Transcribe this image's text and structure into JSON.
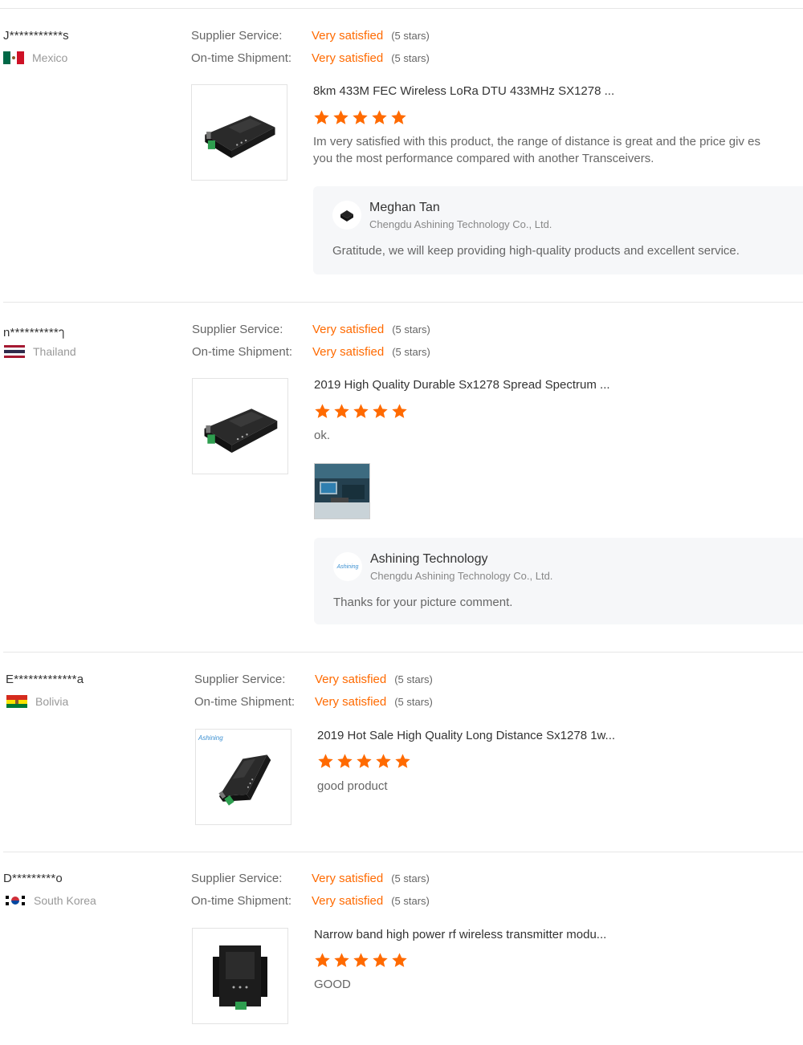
{
  "labels": {
    "supplier_service": "Supplier Service:",
    "ontime_shipment": "On-time Shipment:",
    "stars_note": "(5 stars)"
  },
  "colors": {
    "accent": "#ff6a00",
    "separator": "#e6e6e6",
    "reply_bg": "#f6f7f9"
  },
  "reviews": [
    {
      "buyer": "J***********s",
      "country": "Mexico",
      "flag": "mexico-flag",
      "supplier_service": "Very satisfied",
      "ontime_shipment": "Very satisfied",
      "product_title": "8km 433M FEC Wireless LoRa DTU 433MHz SX1278 ...",
      "rating": 5,
      "comment": "Im very satisfied with this product, the range of distance is great and the price giv es you the most performance compared with another Transceivers.",
      "reply": {
        "name": "Meghan Tan",
        "company": "Chengdu Ashining Technology Co., Ltd.",
        "text": "Gratitude,  we will keep providing high-quality products and excellent service."
      }
    },
    {
      "buyer": "n**********ๅ",
      "country": "Thailand",
      "flag": "thailand-flag",
      "supplier_service": "Very satisfied",
      "ontime_shipment": "Very satisfied",
      "product_title": "2019 High Quality Durable Sx1278 Spread Spectrum ...",
      "rating": 5,
      "comment": "ok.",
      "reply": {
        "name": "Ashining Technology",
        "company": "Chengdu Ashining Technology Co., Ltd.",
        "text": "Thanks for your picture comment.",
        "avatar_text": "Ashining"
      }
    },
    {
      "buyer": "E*************a",
      "country": "Bolivia",
      "flag": "bolivia-flag",
      "supplier_service": "Very satisfied",
      "ontime_shipment": "Very satisfied",
      "product_title": "2019 Hot Sale High Quality Long Distance Sx1278 1w...",
      "rating": 5,
      "comment": "good product",
      "thumb_brand": "Ashining"
    },
    {
      "buyer": "D*********o",
      "country": "South Korea",
      "flag": "south-korea-flag",
      "supplier_service": "Very satisfied",
      "ontime_shipment": "Very satisfied",
      "product_title": "Narrow band high power rf wireless transmitter modu...",
      "rating": 5,
      "comment": "GOOD"
    }
  ]
}
